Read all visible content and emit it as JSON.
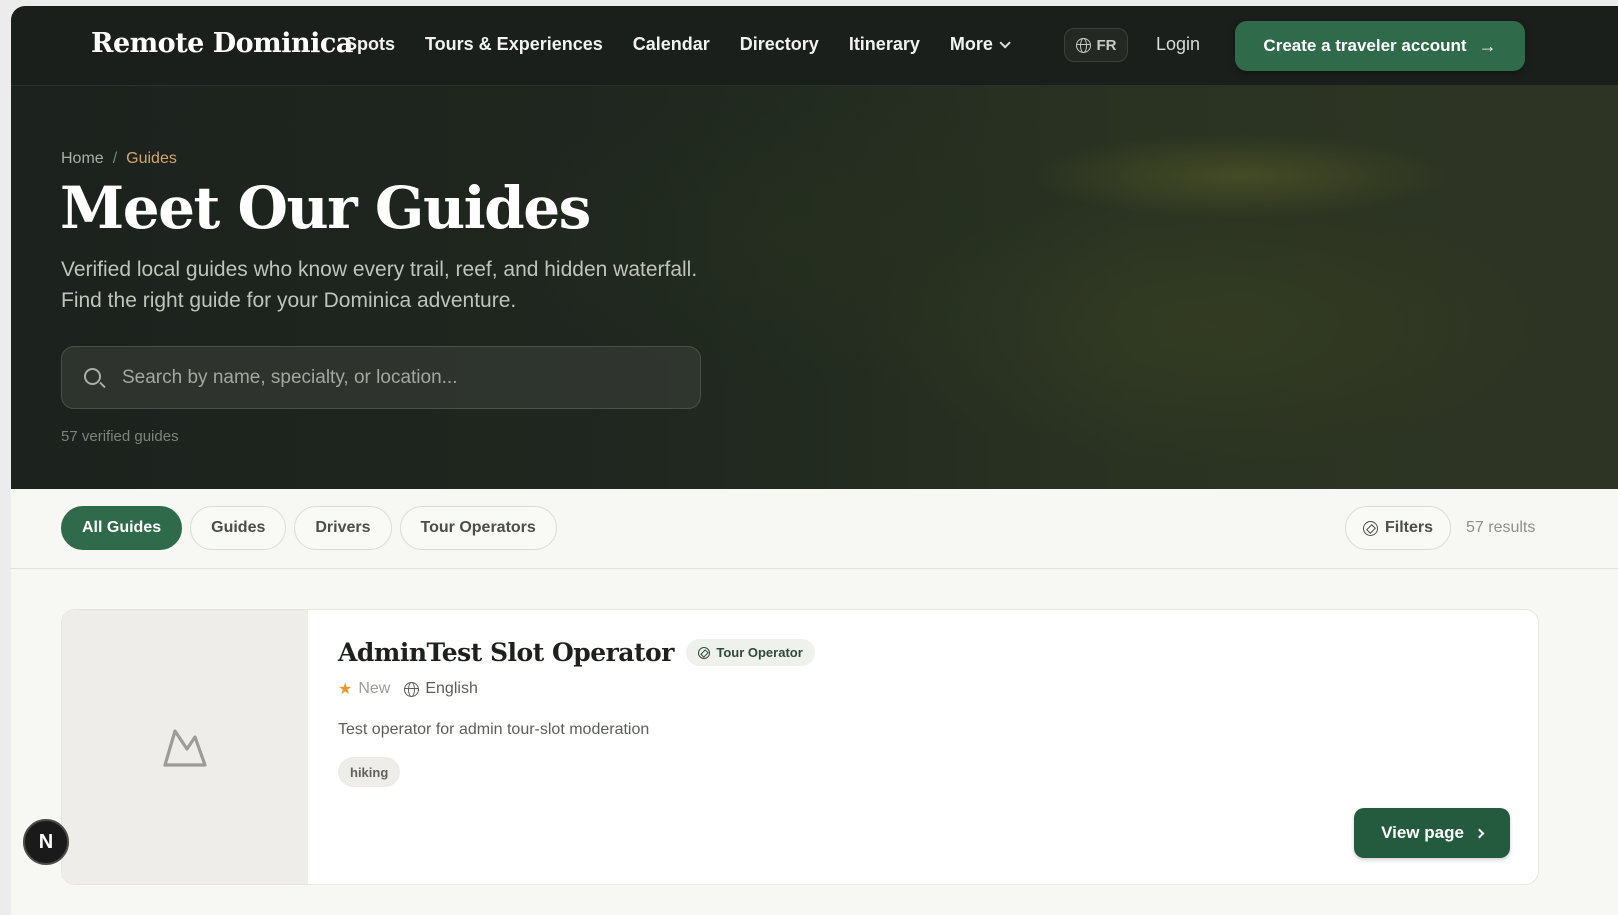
{
  "nav": {
    "brand": "Remote Dominica",
    "links": [
      "Spots",
      "Tours & Experiences",
      "Calendar",
      "Directory",
      "Itinerary"
    ],
    "more_label": "More",
    "lang_label": "FR",
    "login_label": "Login",
    "cta_label": "Create a traveler account"
  },
  "hero": {
    "breadcrumb": {
      "home": "Home",
      "separator": "/",
      "current": "Guides"
    },
    "title": "Meet Our Guides",
    "subtitle": "Verified local guides who know every trail, reef, and hidden waterfall. Find the right guide for your Dominica adventure.",
    "search_placeholder": "Search by name, specialty, or location...",
    "count_text": "57 verified guides"
  },
  "filters": {
    "chips": [
      "All Guides",
      "Guides",
      "Drivers",
      "Tour Operators"
    ],
    "active_chip": "All Guides",
    "filters_label": "Filters",
    "results_text": "57 results"
  },
  "listing": {
    "title": "AdminTest Slot Operator",
    "type_badge": "Tour Operator",
    "rating_label": "New",
    "language": "English",
    "description": "Test operator for admin tour-slot moderation",
    "tags": [
      "hiking"
    ],
    "view_label": "View page",
    "thumbnail_icon": "mountain-icon"
  },
  "dev_badge": {
    "label": "N"
  },
  "colors": {
    "brand_green": "#2f6b4a",
    "nav_bg": "#1b1f1b",
    "breadcrumb_accent": "#d8a468",
    "star": "#e79a2b"
  }
}
